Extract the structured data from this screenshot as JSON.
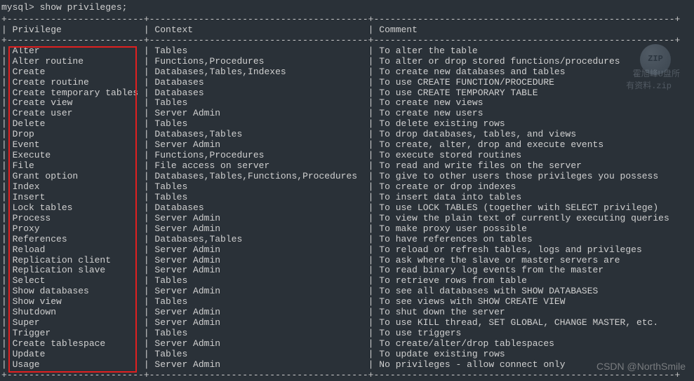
{
  "prompt": "mysql> show privileges;",
  "border": {
    "col1_dashes": "-------------------------",
    "col2_dashes": "----------------------------------------",
    "col3_dashes": "-------------------------------------------------------"
  },
  "headers": {
    "privilege": "Privilege",
    "context": "Context",
    "comment": "Comment"
  },
  "columns": {
    "col1_width": 24,
    "col2_width": 39
  },
  "rows": [
    {
      "privilege": "Alter",
      "context": "Tables",
      "comment": "To alter the table"
    },
    {
      "privilege": "Alter routine",
      "context": "Functions,Procedures",
      "comment": "To alter or drop stored functions/procedures"
    },
    {
      "privilege": "Create",
      "context": "Databases,Tables,Indexes",
      "comment": "To create new databases and tables"
    },
    {
      "privilege": "Create routine",
      "context": "Databases",
      "comment": "To use CREATE FUNCTION/PROCEDURE"
    },
    {
      "privilege": "Create temporary tables",
      "context": "Databases",
      "comment": "To use CREATE TEMPORARY TABLE"
    },
    {
      "privilege": "Create view",
      "context": "Tables",
      "comment": "To create new views"
    },
    {
      "privilege": "Create user",
      "context": "Server Admin",
      "comment": "To create new users"
    },
    {
      "privilege": "Delete",
      "context": "Tables",
      "comment": "To delete existing rows"
    },
    {
      "privilege": "Drop",
      "context": "Databases,Tables",
      "comment": "To drop databases, tables, and views"
    },
    {
      "privilege": "Event",
      "context": "Server Admin",
      "comment": "To create, alter, drop and execute events"
    },
    {
      "privilege": "Execute",
      "context": "Functions,Procedures",
      "comment": "To execute stored routines"
    },
    {
      "privilege": "File",
      "context": "File access on server",
      "comment": "To read and write files on the server"
    },
    {
      "privilege": "Grant option",
      "context": "Databases,Tables,Functions,Procedures",
      "comment": "To give to other users those privileges you possess"
    },
    {
      "privilege": "Index",
      "context": "Tables",
      "comment": "To create or drop indexes"
    },
    {
      "privilege": "Insert",
      "context": "Tables",
      "comment": "To insert data into tables"
    },
    {
      "privilege": "Lock tables",
      "context": "Databases",
      "comment": "To use LOCK TABLES (together with SELECT privilege)"
    },
    {
      "privilege": "Process",
      "context": "Server Admin",
      "comment": "To view the plain text of currently executing queries"
    },
    {
      "privilege": "Proxy",
      "context": "Server Admin",
      "comment": "To make proxy user possible"
    },
    {
      "privilege": "References",
      "context": "Databases,Tables",
      "comment": "To have references on tables"
    },
    {
      "privilege": "Reload",
      "context": "Server Admin",
      "comment": "To reload or refresh tables, logs and privileges"
    },
    {
      "privilege": "Replication client",
      "context": "Server Admin",
      "comment": "To ask where the slave or master servers are"
    },
    {
      "privilege": "Replication slave",
      "context": "Server Admin",
      "comment": "To read binary log events from the master"
    },
    {
      "privilege": "Select",
      "context": "Tables",
      "comment": "To retrieve rows from table"
    },
    {
      "privilege": "Show databases",
      "context": "Server Admin",
      "comment": "To see all databases with SHOW DATABASES"
    },
    {
      "privilege": "Show view",
      "context": "Tables",
      "comment": "To see views with SHOW CREATE VIEW"
    },
    {
      "privilege": "Shutdown",
      "context": "Server Admin",
      "comment": "To shut down the server"
    },
    {
      "privilege": "Super",
      "context": "Server Admin",
      "comment": "To use KILL thread, SET GLOBAL, CHANGE MASTER, etc."
    },
    {
      "privilege": "Trigger",
      "context": "Tables",
      "comment": "To use triggers"
    },
    {
      "privilege": "Create tablespace",
      "context": "Server Admin",
      "comment": "To create/alter/drop tablespaces"
    },
    {
      "privilege": "Update",
      "context": "Tables",
      "comment": "To update existing rows"
    },
    {
      "privilege": "Usage",
      "context": "Server Admin",
      "comment": "No privileges - allow connect only"
    }
  ],
  "watermarks": {
    "zip_label": "ZIP",
    "text_line1": "霍旭峰U盘所",
    "text_line2": "有资料.zip",
    "csdn": "CSDN @NorthSmile"
  }
}
